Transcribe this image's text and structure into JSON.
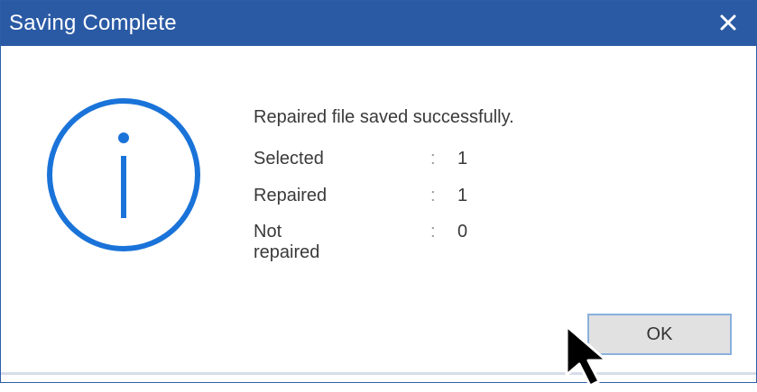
{
  "window": {
    "title": "Saving Complete",
    "close_icon": "close-icon"
  },
  "colors": {
    "titlebar": "#2b5aa5",
    "accent": "#1a73d9",
    "button_bg": "#e1e1e1",
    "button_border": "#8ab0dc"
  },
  "content": {
    "icon": "info-icon",
    "message": "Repaired file saved successfully.",
    "stats": [
      {
        "label": "Selected",
        "separator": ":",
        "value": "1"
      },
      {
        "label": "Repaired",
        "separator": ":",
        "value": "1"
      },
      {
        "label": "Not repaired",
        "separator": ":",
        "value": "0"
      }
    ]
  },
  "buttons": {
    "ok_label": "OK"
  }
}
